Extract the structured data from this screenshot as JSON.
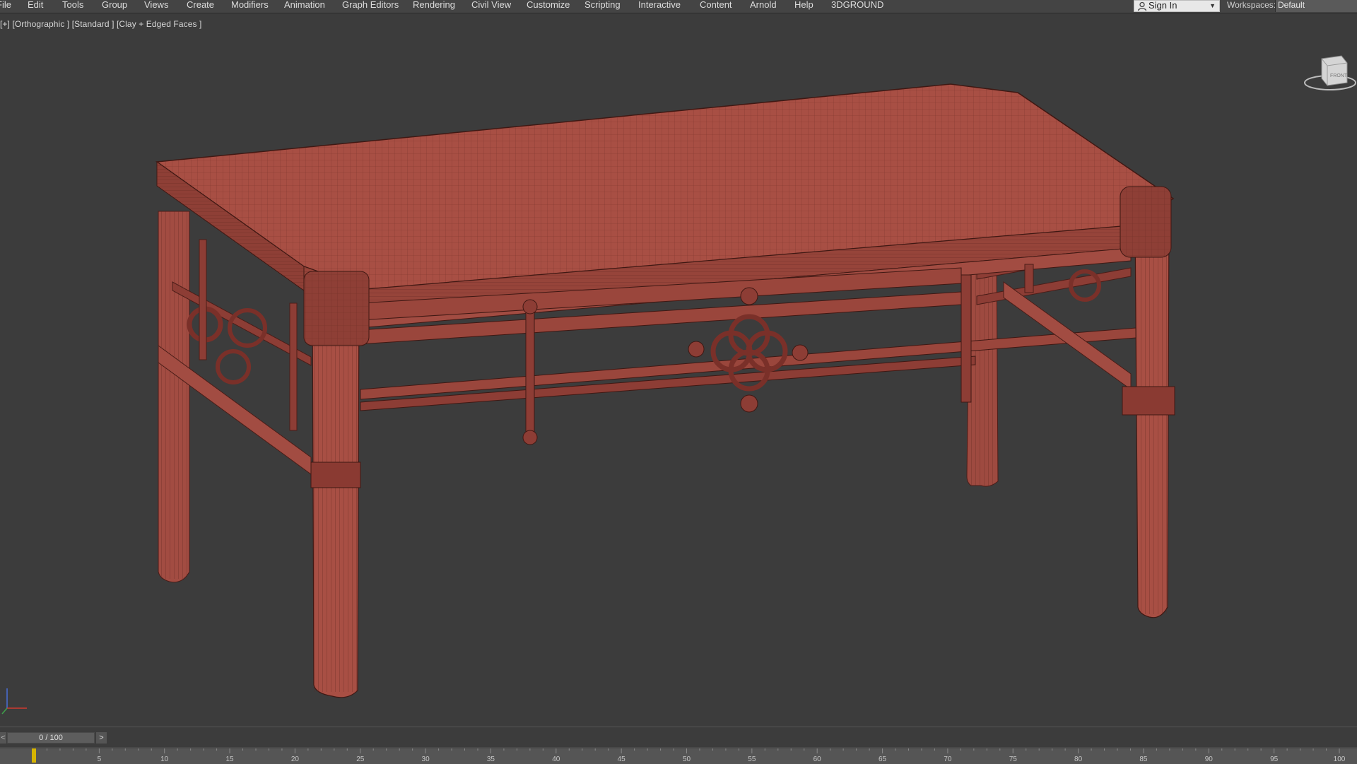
{
  "menu": {
    "items": [
      "File",
      "Edit",
      "Tools",
      "Group",
      "Views",
      "Create",
      "Modifiers",
      "Animation",
      "Graph Editors",
      "Rendering",
      "Civil View",
      "Customize",
      "Scripting",
      "Interactive",
      "Content",
      "Arnold",
      "Help",
      "3DGROUND"
    ]
  },
  "signin": {
    "label": "Sign In"
  },
  "workspaces": {
    "label": "Workspaces:",
    "value": "Default"
  },
  "viewport": {
    "label": "[+] [Orthographic ] [Standard ] [Clay + Edged Faces ]",
    "object_color": "#a34d43",
    "wire_color": "#5a231d",
    "viewcube_face": "FRONT"
  },
  "timeline": {
    "slider_text": "0 / 100",
    "prev": "<",
    "next": ">",
    "current_frame": 0,
    "total_frames": 100,
    "tick_labels": [
      "5",
      "10",
      "15",
      "20",
      "25",
      "30",
      "35",
      "40",
      "45",
      "50",
      "55",
      "60",
      "65",
      "70",
      "75",
      "80",
      "85",
      "90",
      "95",
      "100"
    ]
  },
  "colors": {
    "background": "#3c3c3c",
    "menubar": "#444444",
    "timeline_key": "#d6b400"
  }
}
